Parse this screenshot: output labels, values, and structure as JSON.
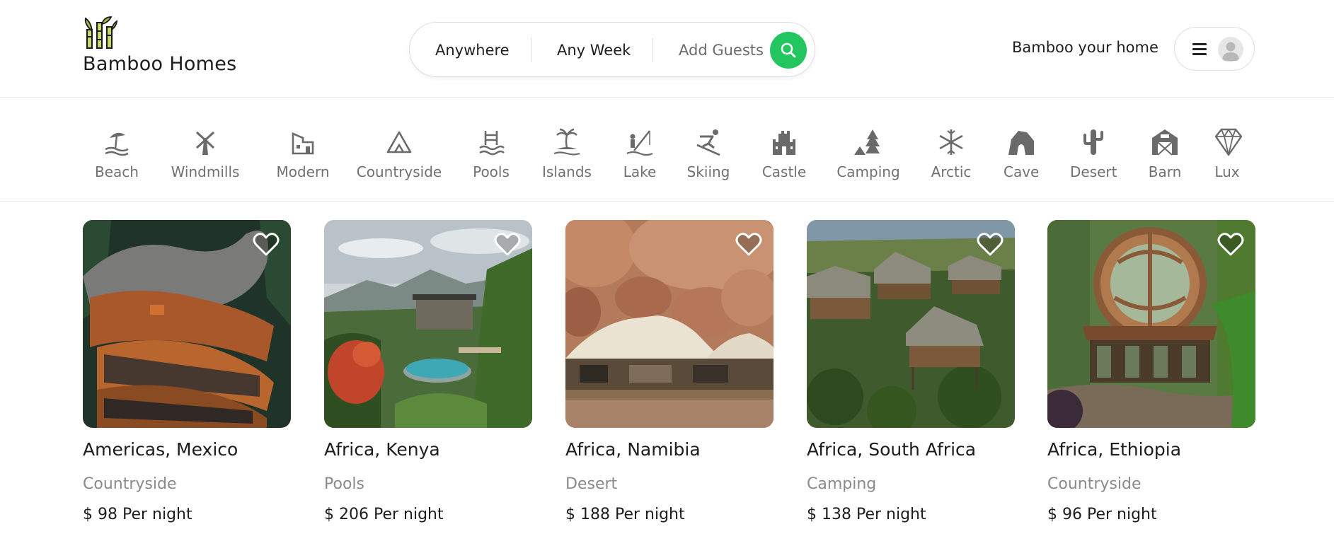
{
  "app": {
    "name": "Bamboo Homes",
    "accent": "#22c55e"
  },
  "search": {
    "where": "Anywhere",
    "when": "Any Week",
    "guests_placeholder": "Add Guests",
    "button_icon": "search-icon"
  },
  "header": {
    "host_link": "Bamboo your home",
    "menu_icon": "hamburger-icon",
    "avatar_icon": "user-avatar-icon"
  },
  "categories": [
    {
      "label": "Beach",
      "icon": "beach-umbrella-icon"
    },
    {
      "label": "Windmills",
      "icon": "windmill-icon"
    },
    {
      "label": "Modern",
      "icon": "modern-house-icon"
    },
    {
      "label": "Countryside",
      "icon": "mountain-icon"
    },
    {
      "label": "Pools",
      "icon": "pool-icon"
    },
    {
      "label": "Islands",
      "icon": "palm-island-icon"
    },
    {
      "label": "Lake",
      "icon": "fishing-lake-icon"
    },
    {
      "label": "Skiing",
      "icon": "skier-icon"
    },
    {
      "label": "Castle",
      "icon": "castle-icon"
    },
    {
      "label": "Camping",
      "icon": "tent-tree-icon"
    },
    {
      "label": "Arctic",
      "icon": "snowflake-icon"
    },
    {
      "label": "Cave",
      "icon": "cave-icon"
    },
    {
      "label": "Desert",
      "icon": "cactus-icon"
    },
    {
      "label": "Barn",
      "icon": "barn-icon"
    },
    {
      "label": "Lux",
      "icon": "diamond-icon"
    }
  ],
  "listings": [
    {
      "location": "Americas, Mexico",
      "category": "Countryside",
      "price": "$ 98",
      "per": "Per night"
    },
    {
      "location": "Africa, Kenya",
      "category": "Pools",
      "price": "$ 206",
      "per": "Per night"
    },
    {
      "location": "Africa, Namibia",
      "category": "Desert",
      "price": "$ 188",
      "per": "Per night"
    },
    {
      "location": "Africa, South Africa",
      "category": "Camping",
      "price": "$ 138",
      "per": "Per night"
    },
    {
      "location": "Africa, Ethiopia",
      "category": "Countryside",
      "price": "$ 96",
      "per": "Per night"
    }
  ]
}
